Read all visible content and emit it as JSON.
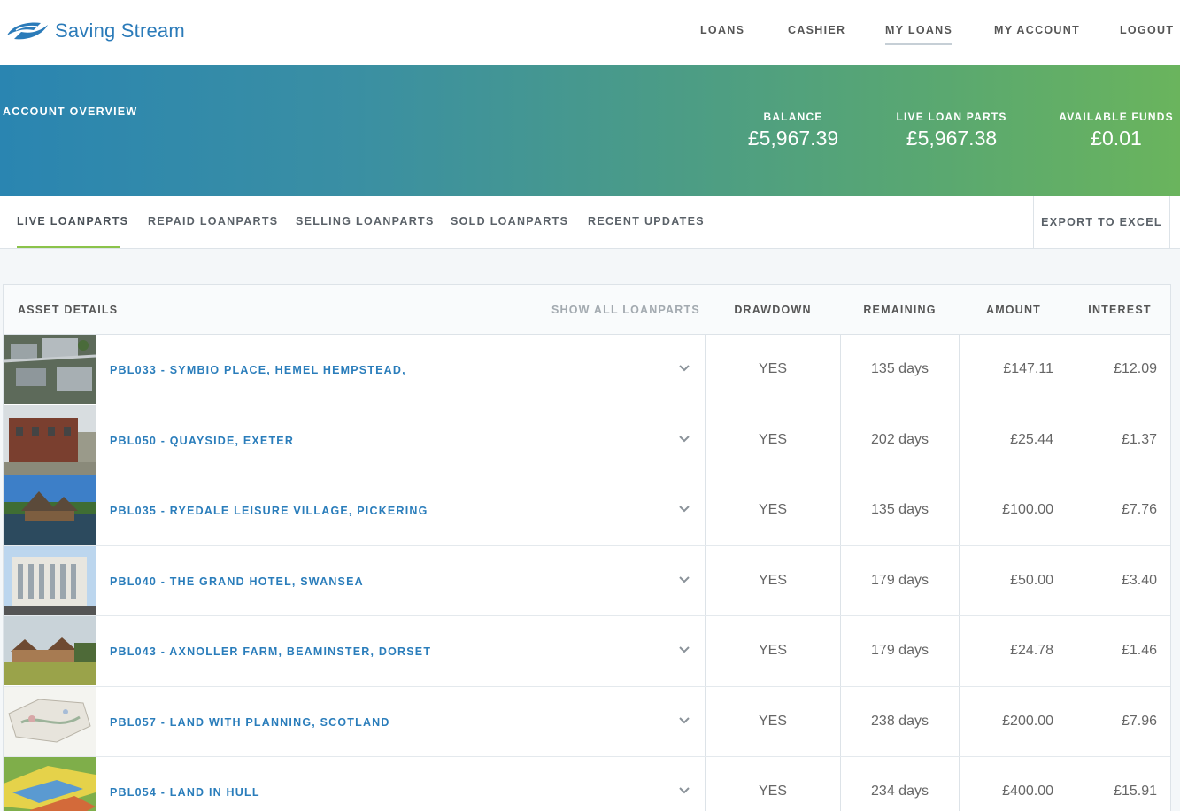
{
  "brand": {
    "name": "Saving Stream"
  },
  "nav": {
    "items": [
      {
        "label": "LOANS"
      },
      {
        "label": "CASHIER"
      },
      {
        "label": "MY LOANS"
      },
      {
        "label": "MY ACCOUNT"
      },
      {
        "label": "LOGOUT"
      }
    ],
    "active": "MY LOANS"
  },
  "overview": {
    "title": "ACCOUNT OVERVIEW",
    "balance_label": "BALANCE",
    "balance_value": "£5,967.39",
    "live_label": "LIVE LOAN PARTS",
    "live_value": "£5,967.38",
    "funds_label": "AVAILABLE FUNDS",
    "funds_value": "£0.01"
  },
  "tabs": {
    "items": [
      {
        "label": "LIVE LOANPARTS"
      },
      {
        "label": "REPAID LOANPARTS"
      },
      {
        "label": "SELLING LOANPARTS"
      },
      {
        "label": "SOLD LOANPARTS"
      },
      {
        "label": "RECENT UPDATES"
      }
    ],
    "active": "LIVE LOANPARTS",
    "export_label": "EXPORT TO EXCEL"
  },
  "table": {
    "headers": {
      "asset": "ASSET DETAILS",
      "show_all": "SHOW ALL LOANPARTS",
      "drawdown": "DRAWDOWN",
      "remaining": "REMAINING",
      "amount": "AMOUNT",
      "interest": "INTEREST"
    },
    "rows": [
      {
        "asset": "PBL033 - SYMBIO PLACE, HEMEL HEMPSTEAD,",
        "drawdown": "YES",
        "remaining": "135 days",
        "amount": "£147.11",
        "interest": "£12.09"
      },
      {
        "asset": "PBL050 - QUAYSIDE, EXETER",
        "drawdown": "YES",
        "remaining": "202 days",
        "amount": "£25.44",
        "interest": "£1.37"
      },
      {
        "asset": "PBL035 - RYEDALE LEISURE VILLAGE, PICKERING",
        "drawdown": "YES",
        "remaining": "135 days",
        "amount": "£100.00",
        "interest": "£7.76"
      },
      {
        "asset": "PBL040 - THE GRAND HOTEL, SWANSEA",
        "drawdown": "YES",
        "remaining": "179 days",
        "amount": "£50.00",
        "interest": "£3.40"
      },
      {
        "asset": "PBL043 - AXNOLLER FARM, BEAMINSTER, DORSET",
        "drawdown": "YES",
        "remaining": "179 days",
        "amount": "£24.78",
        "interest": "£1.46"
      },
      {
        "asset": "PBL057 - LAND WITH PLANNING, SCOTLAND",
        "drawdown": "YES",
        "remaining": "238 days",
        "amount": "£200.00",
        "interest": "£7.96"
      },
      {
        "asset": "PBL054 - LAND IN HULL",
        "drawdown": "YES",
        "remaining": "234 days",
        "amount": "£400.00",
        "interest": "£15.91"
      }
    ]
  },
  "colors": {
    "brand_blue": "#2b7bb9",
    "link_blue": "#2a7dbb",
    "active_tab_green": "#8bc34a",
    "banner_start": "#2a85b1",
    "banner_end": "#6ab45d"
  }
}
